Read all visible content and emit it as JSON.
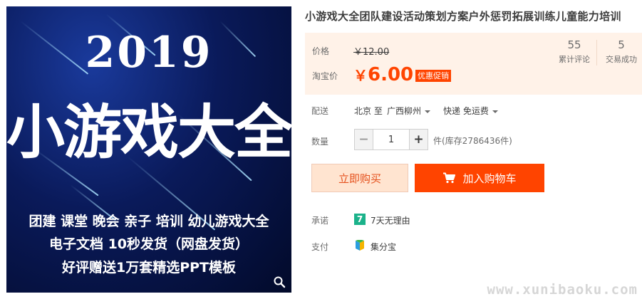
{
  "product_image": {
    "year": "2019",
    "title": "小游戏大全",
    "line1": "团建  课堂  晚会  亲子  培训  幼儿游戏大全",
    "line2": "电子文档  10秒发货（网盘发货）",
    "line3": "好评赠送1万套精选PPT模板",
    "zoom_icon": "magnifier-icon"
  },
  "product": {
    "title": "小游戏大全团队建设活动策划方案户外惩罚拓展训练儿童能力培训"
  },
  "price": {
    "label": "价格",
    "original": "￥12.00",
    "taobao_label": "淘宝价",
    "currency": "￥",
    "amount": "6.00",
    "promo_badge": "优惠促销",
    "accent_color": "#ff4400"
  },
  "stats": {
    "reviews_count": "55",
    "reviews_label": "累计评论",
    "deals_count": "5",
    "deals_label": "交易成功"
  },
  "delivery": {
    "label": "配送",
    "from": "北京 至",
    "to": "广西柳州",
    "method": "快递 免运费"
  },
  "quantity": {
    "label": "数量",
    "minus": "−",
    "plus": "+",
    "value": "1",
    "stock": "件(库存2786436件)"
  },
  "actions": {
    "buy_now": "立即购买",
    "add_to_cart": "加入购物车",
    "cart_icon": "cart-icon"
  },
  "promise": {
    "label": "承诺",
    "badge": "7",
    "text": "7天无理由"
  },
  "payment": {
    "label": "支付",
    "text": "集分宝",
    "icon": "jifenbao-icon"
  },
  "watermark": "www.xunibaoku.com"
}
